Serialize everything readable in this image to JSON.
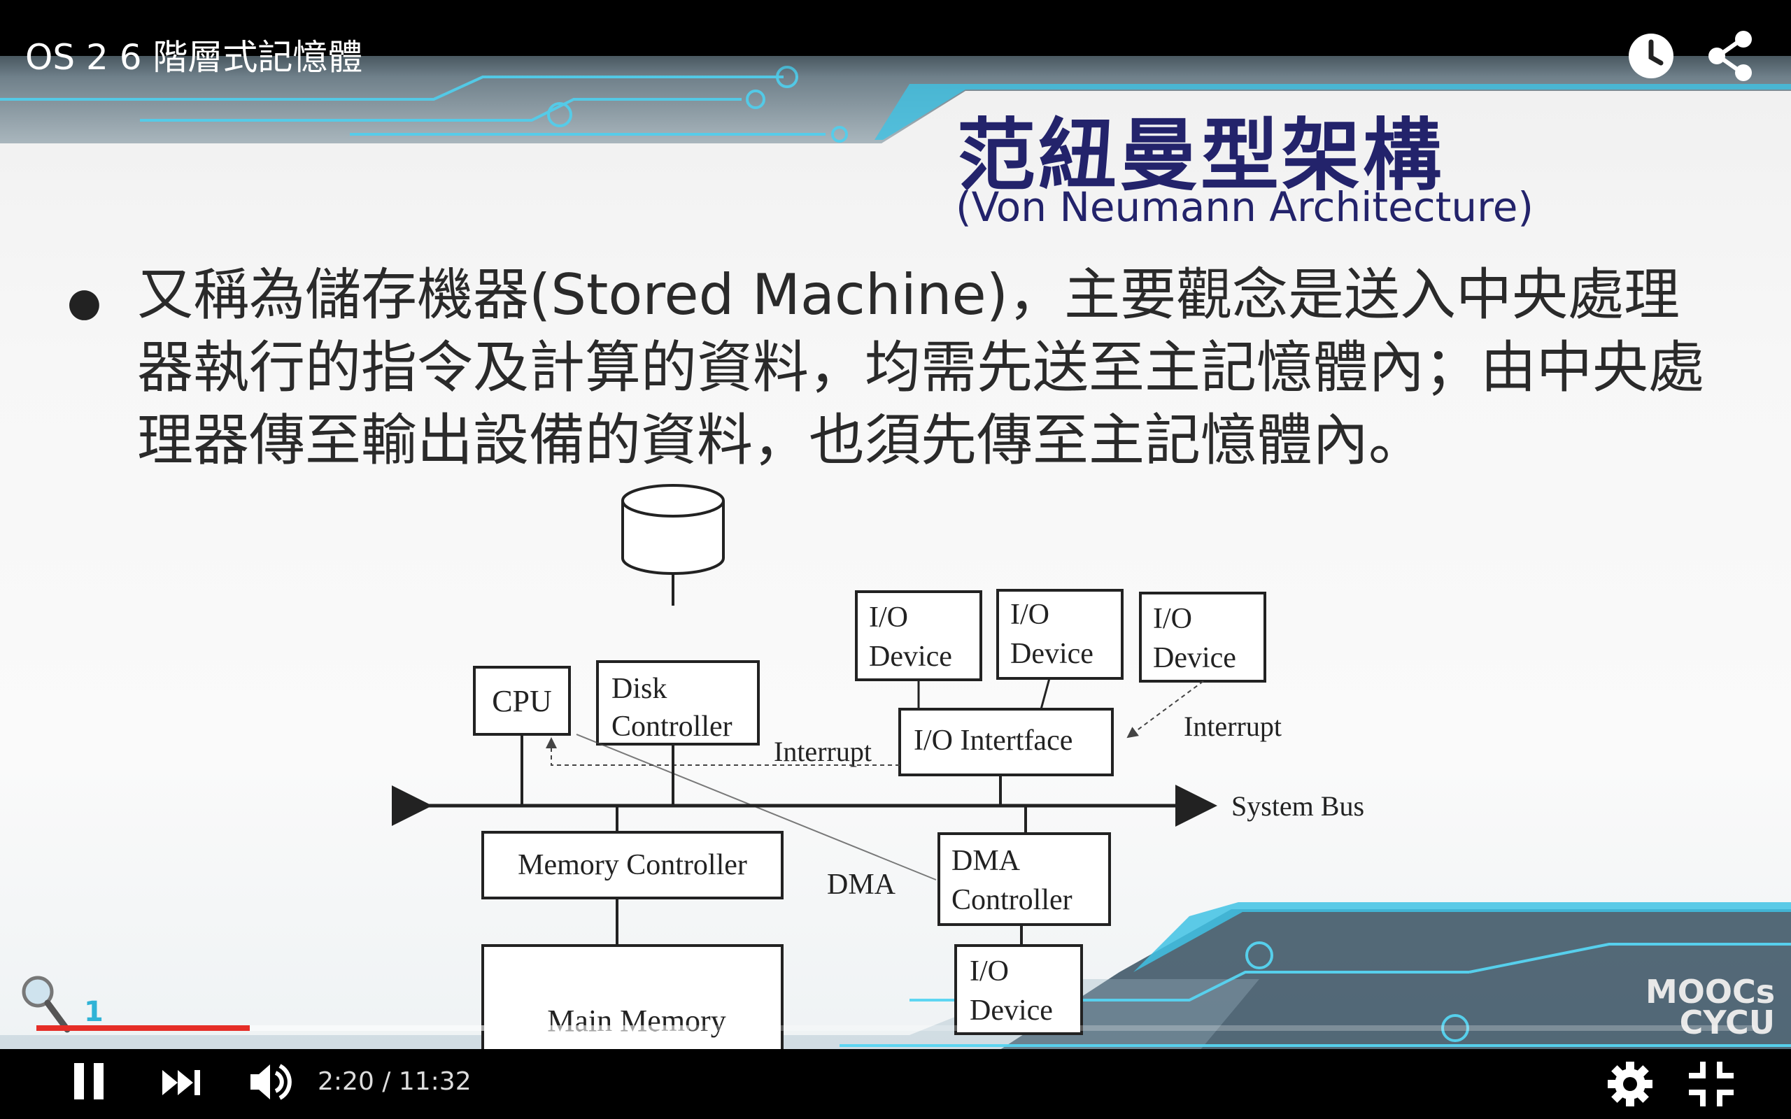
{
  "video": {
    "title": "OS 2 6 階層式記憶體",
    "current_time": "2:20",
    "separator": " / ",
    "duration": "11:32",
    "played_fraction": 0.124,
    "buffered_fraction": 0.38
  },
  "slide": {
    "title": "范紐曼型架構",
    "subtitle": "(Von Neumann Architecture)",
    "bullet": "又稱為儲存機器(Stored Machine)，主要觀念是送入中央處理器執行的指令及計算的資料，均需先送至主記憶體內；由中央處理器傳至輸出設備的資料，也須先傳至主記憶體內。",
    "page_number": "1",
    "logo_text": [
      "MOOCs",
      "CYCU"
    ]
  },
  "diagram": {
    "cpu": "CPU",
    "disk_controller": [
      "Disk",
      "Controller"
    ],
    "io_device": [
      "I/O",
      "Device"
    ],
    "io_interface": "I/O Intertface",
    "interrupt_left": "Interrupt",
    "interrupt_right": "Interrupt",
    "system_bus": "System Bus",
    "memory_controller": "Memory Controller",
    "dma_label": "DMA",
    "dma_controller": [
      "DMA",
      "Controller"
    ],
    "main_memory": "Main Memory"
  },
  "icons": {
    "watch_later": "clock-icon",
    "share": "share-icon",
    "play_pause": "pause-icon",
    "next": "next-icon",
    "volume": "volume-icon",
    "settings": "gear-icon",
    "fullscreen": "exit-fullscreen-icon"
  },
  "colors": {
    "progress_played": "#e52d27",
    "slide_title": "#23236b",
    "accent_cyan": "#2fb3d6"
  }
}
